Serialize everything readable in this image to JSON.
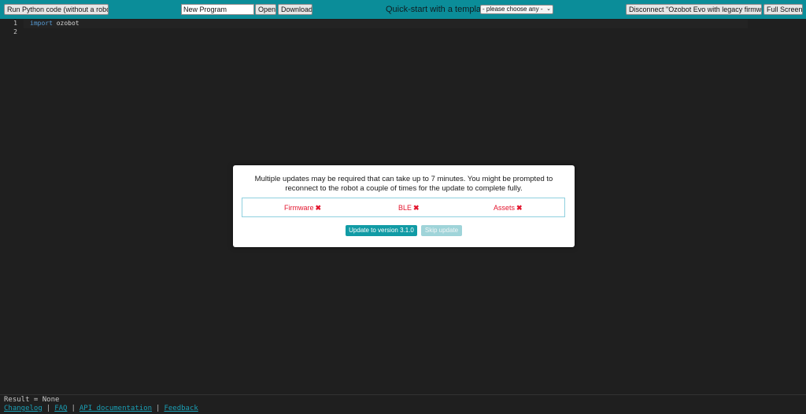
{
  "toolbar": {
    "run_label": "Run Python code (without a robot)",
    "program_name": "New Program",
    "open_label": "Open",
    "download_label": "Download",
    "quickstart_label": "Quick-start with a template:",
    "template_select": "- please choose any -",
    "disconnect_label": "Disconnect \"Ozobot Evo with legacy firmware\"",
    "fullscreen_label": "Full Screen"
  },
  "editor": {
    "lines": [
      {
        "num": "1",
        "keyword": "import",
        "rest": " ozobot"
      },
      {
        "num": "2",
        "keyword": "",
        "rest": ""
      }
    ]
  },
  "modal": {
    "message": "Multiple updates may be required that can take up to 7 minutes. You might be prompted to reconnect to the robot a couple of times for the update to complete fully.",
    "status": [
      {
        "label": "Firmware",
        "mark": "✖"
      },
      {
        "label": "BLE",
        "mark": "✖"
      },
      {
        "label": "Assets",
        "mark": "✖"
      }
    ],
    "update_label": "Update to version 3.1.0",
    "skip_label": "Skip update"
  },
  "result": "Result = None",
  "footer": {
    "links": [
      "Changelog",
      "FAQ",
      "API documentation",
      "Feedback"
    ],
    "separator": "|"
  },
  "colors": {
    "toolbar_bg": "#0b8d99",
    "editor_bg": "#1f1f1f",
    "error_red": "#e3162f",
    "primary_button": "#119ba5",
    "link": "#1a9fb5"
  }
}
